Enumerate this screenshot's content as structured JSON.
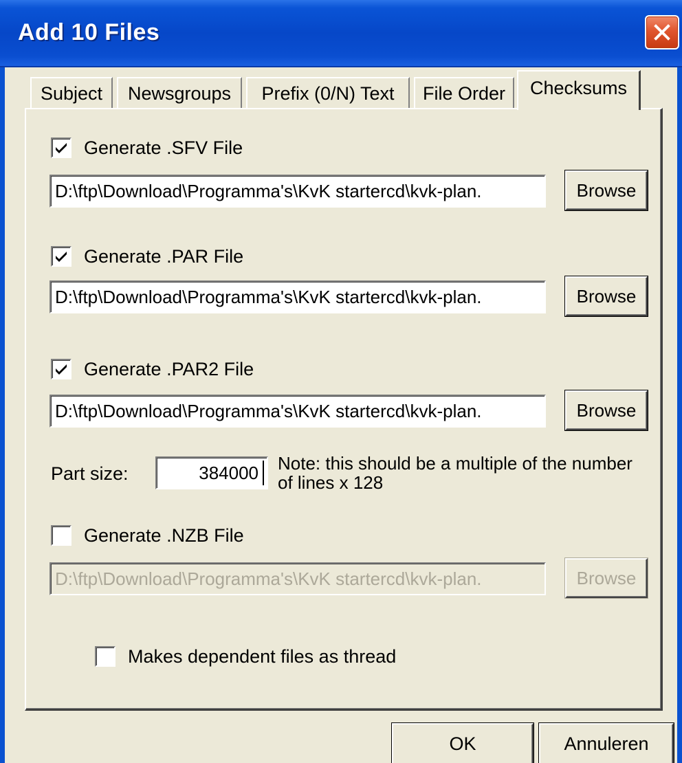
{
  "window": {
    "title": "Add 10 Files",
    "close_icon": "close-icon"
  },
  "tabs": [
    {
      "label": "Subject",
      "active": false
    },
    {
      "label": "Newsgroups",
      "active": false
    },
    {
      "label": "Prefix (0/N) Text",
      "active": false
    },
    {
      "label": "File Order",
      "active": false
    },
    {
      "label": "Checksums",
      "active": true
    }
  ],
  "checksums": {
    "sfv": {
      "label": "Generate .SFV File",
      "checked": true,
      "path": "D:\\ftp\\Download\\Programma's\\KvK startercd\\kvk-plan.",
      "browse": "Browse",
      "enabled": true
    },
    "par": {
      "label": "Generate .PAR File",
      "checked": true,
      "path": "D:\\ftp\\Download\\Programma's\\KvK startercd\\kvk-plan.",
      "browse": "Browse",
      "enabled": true
    },
    "par2": {
      "label": "Generate .PAR2 File",
      "checked": true,
      "path": "D:\\ftp\\Download\\Programma's\\KvK startercd\\kvk-plan.",
      "browse": "Browse",
      "enabled": true
    },
    "part_size": {
      "label": "Part size:",
      "value": "384000",
      "note": "Note: this should be a multiple of the number of lines x 128"
    },
    "nzb": {
      "label": "Generate .NZB File",
      "checked": false,
      "path": "D:\\ftp\\Download\\Programma's\\KvK startercd\\kvk-plan.",
      "browse": "Browse",
      "enabled": false
    },
    "thread": {
      "label": "Makes dependent files as thread",
      "checked": false
    }
  },
  "footer": {
    "ok": "OK",
    "cancel": "Annuleren"
  }
}
